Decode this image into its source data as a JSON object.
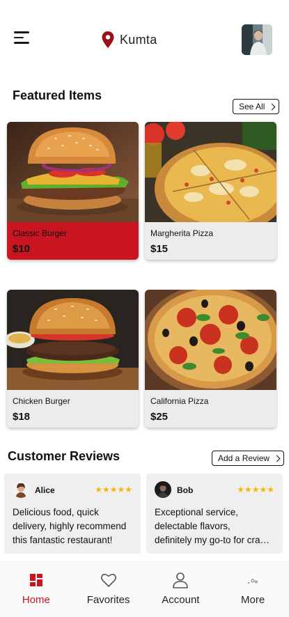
{
  "header": {
    "location": "Kumta",
    "pin_color": "#9b1018"
  },
  "featured": {
    "title": "Featured Items",
    "see_all_label": "See All",
    "items": [
      {
        "name": "Classic Burger",
        "price": "$10",
        "selected": true
      },
      {
        "name": "Margherita Pizza",
        "price": "$15",
        "selected": false
      },
      {
        "name": "Chicken Burger",
        "price": "$18",
        "selected": false
      },
      {
        "name": "California Pizza",
        "price": "$25",
        "selected": false
      }
    ]
  },
  "reviews": {
    "title": "Customer Reviews",
    "add_label": "Add a Review",
    "items": [
      {
        "name": "Alice",
        "rating": 5,
        "stars": "★★★★★",
        "text_lines": [
          "Delicious food, quick",
          "delivery, highly recommend",
          "this fantastic restaurant!"
        ]
      },
      {
        "name": "Bob",
        "rating": 5,
        "stars": "★★★★★",
        "text_lines": [
          "Exceptional service,",
          "delectable flavors,",
          "definitely my go-to for cra…"
        ]
      }
    ]
  },
  "nav": {
    "items": [
      {
        "label": "Home",
        "icon": "home-grid-icon",
        "active": true
      },
      {
        "label": "Favorites",
        "icon": "heart-icon",
        "active": false
      },
      {
        "label": "Account",
        "icon": "user-icon",
        "active": false
      },
      {
        "label": "More",
        "icon": "more-dots-icon",
        "active": false
      }
    ]
  },
  "colors": {
    "accent": "#c8151f",
    "card_bg": "#ececec",
    "star": "#f5b800"
  }
}
